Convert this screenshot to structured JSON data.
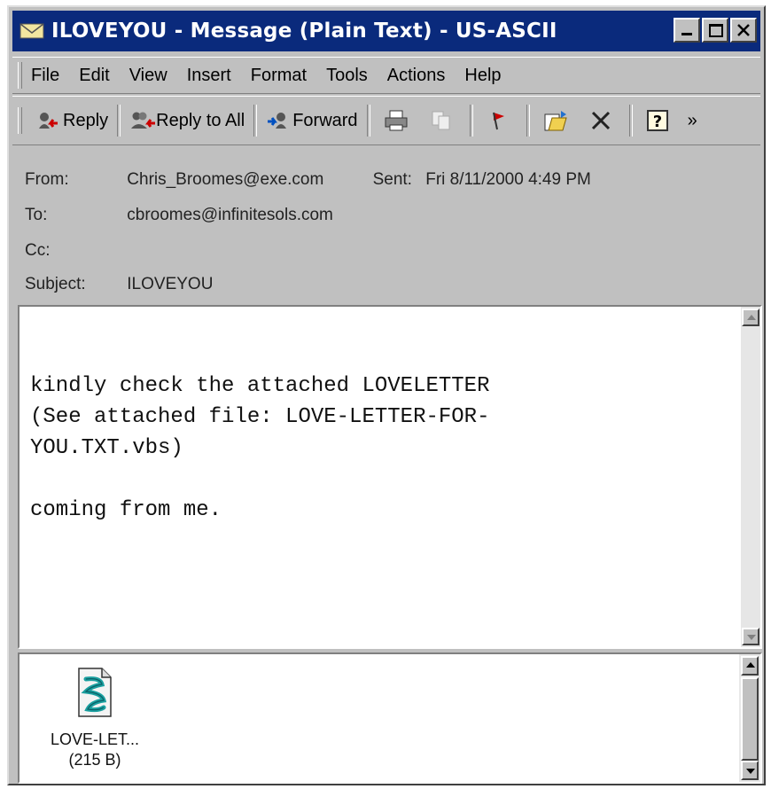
{
  "window": {
    "title": "ILOVEYOU - Message (Plain Text)  - US-ASCII"
  },
  "menu": [
    {
      "label": "File"
    },
    {
      "label": "Edit"
    },
    {
      "label": "View"
    },
    {
      "label": "Insert"
    },
    {
      "label": "Format"
    },
    {
      "label": "Tools"
    },
    {
      "label": "Actions"
    },
    {
      "label": "Help"
    }
  ],
  "toolbar": {
    "reply": "Reply",
    "reply_all": "Reply to All",
    "forward": "Forward",
    "overflow": "»"
  },
  "header": {
    "from_label": "From:",
    "from_value": "Chris_Broomes@exe.com",
    "sent_label": "Sent:",
    "sent_value": "Fri 8/11/2000 4:49 PM",
    "to_label": "To:",
    "to_value": "cbroomes@infinitesols.com",
    "cc_label": "Cc:",
    "cc_value": "",
    "subject_label": "Subject:",
    "subject_value": "ILOVEYOU"
  },
  "body": {
    "text": "kindly check the attached LOVELETTER\n(See attached file: LOVE-LETTER-FOR-\nYOU.TXT.vbs)\n\ncoming from me."
  },
  "attachment": {
    "name": "LOVE-LET...",
    "size": "(215 B)",
    "icon": "script-file-icon"
  },
  "colors": {
    "titlebar": "#0a2a7c",
    "chrome": "#c0c0c0"
  }
}
